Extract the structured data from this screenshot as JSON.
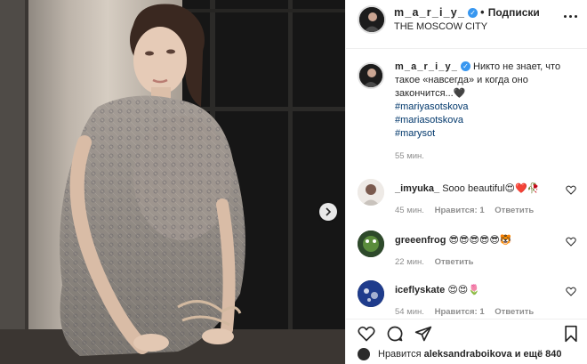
{
  "post": {
    "author": "m_a_r_i_y_",
    "follow_label": "Подписки",
    "location": "THE MOSCOW CITY"
  },
  "caption": {
    "username": "m_a_r_i_y_",
    "text": "Никто не знает, что такое «навсегда» и когда оно закончится...🖤",
    "hashtags": [
      "#mariyasotskova",
      "#mariasotskova",
      "#marysot"
    ],
    "time": "55 мин."
  },
  "comments": [
    {
      "username": "_imyuka_",
      "text": "Sooo beautiful😍❤️🥀",
      "time": "45 мин.",
      "likes": "Нравится: 1",
      "reply": "Ответить"
    },
    {
      "username": "greeenfrog",
      "text": "😎😎😎😎😎🐯",
      "time": "22 мин.",
      "likes": "",
      "reply": "Ответить"
    },
    {
      "username": "iceflyskate",
      "text": "😍😍🌷",
      "time": "54 мин.",
      "likes": "Нравится: 1",
      "reply": "Ответить"
    }
  ],
  "likes_line": {
    "prefix": "Нравится ",
    "user": "aleksandraboikova",
    "suffix": " и ещё 840"
  },
  "colors": {
    "link": "#00376b",
    "verified": "#3897f0",
    "muted": "#8e8e8e",
    "text": "#262626"
  },
  "icons": [
    "verified-badge-icon",
    "more-options-icon",
    "heart-icon",
    "comment-icon",
    "share-icon",
    "bookmark-icon",
    "chevron-right-icon"
  ]
}
